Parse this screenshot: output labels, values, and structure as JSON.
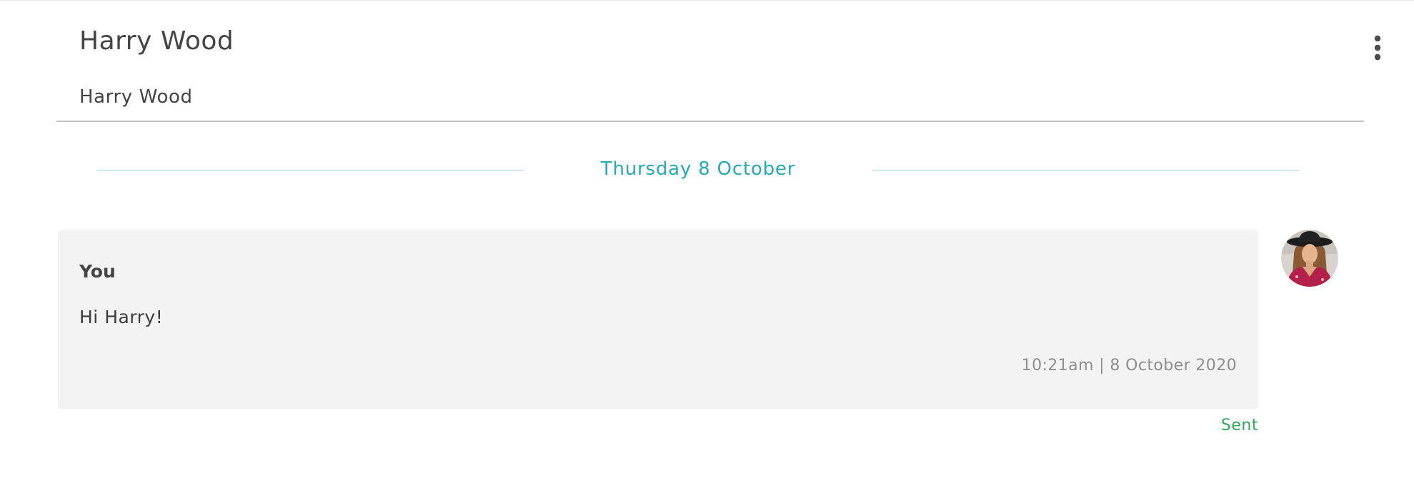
{
  "header": {
    "title": "Harry Wood",
    "subtitle": "Harry Wood",
    "menu_icon": "more-vertical-icon"
  },
  "thread": {
    "date_divider": "Thursday 8 October",
    "messages": [
      {
        "sender": "You",
        "text": "Hi Harry!",
        "timestamp": "10:21am | 8 October 2020",
        "status": "Sent",
        "avatar": "user-avatar"
      }
    ]
  },
  "colors": {
    "accent": "#26aab5",
    "status_sent": "#2ea85a",
    "bubble_bg": "#f3f3f3",
    "divider_line": "#cbe9f2"
  }
}
